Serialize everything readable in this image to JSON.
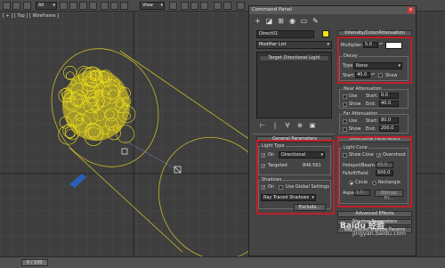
{
  "toolbar": {
    "selection_filter": "All",
    "view_dropdown": "View"
  },
  "viewport": {
    "label": "[ + ] [ Top ] [ Wireframe ]"
  },
  "timeline": {
    "frame_text": "0 / 100"
  },
  "command_panel": {
    "title": "Command Panel",
    "close_glyph": "x",
    "tabs": [
      {
        "icon": "plus-icon",
        "glyph": "+"
      },
      {
        "icon": "modify-icon",
        "glyph": "◪"
      },
      {
        "icon": "hierarchy-icon",
        "glyph": "⊞"
      },
      {
        "icon": "motion-icon",
        "glyph": "◉"
      },
      {
        "icon": "display-icon",
        "glyph": "▭"
      },
      {
        "icon": "utilities-icon",
        "glyph": "✎"
      }
    ],
    "object_name": "Direct01",
    "modifier_list": "Modifier List",
    "stack_item": "Target Directional Light",
    "stack_buttons": [
      "⊢",
      "|",
      "∀",
      "⊕",
      "▣"
    ]
  },
  "general_parameters": {
    "title": "General Parameters",
    "light_type_label": "Light Type",
    "on_label": "On",
    "light_type_value": "Directional",
    "targeted_label": "Targeted",
    "targeted_value": "846.561",
    "shadows_label": "Shadows",
    "shadows_on_label": "On",
    "use_global_label": "Use Global Settings",
    "shadow_type": "Ray Traced Shadows",
    "exclude_button": "Exclude..."
  },
  "intensity": {
    "title": "Intensity/Color/Attenuation",
    "multiplier_label": "Multiplier:",
    "multiplier_value": "5.0",
    "decay_label": "Decay",
    "type_label": "Type:",
    "type_value": "None",
    "start_label": "Start:",
    "start_value": "40.0",
    "show_label": "Show"
  },
  "near_attenuation": {
    "title": "Near Attenuation",
    "use_label": "Use",
    "show_label": "Show",
    "start_label": "Start:",
    "start_value": "0.0",
    "end_label": "End:",
    "end_value": "40.0"
  },
  "far_attenuation": {
    "title": "Far Attenuation",
    "use_label": "Use",
    "show_label": "Show",
    "start_label": "Start:",
    "start_value": "80.0",
    "end_label": "End:",
    "end_value": "200.0"
  },
  "directional_parameters": {
    "title": "Directional Parameters",
    "light_cone_label": "Light Cone",
    "show_cone_label": "Show Cone",
    "overshoot_label": "Overshoot",
    "hotspot_label": "Hotspot/Beam:",
    "hotspot_value": "43.0",
    "falloff_label": "Falloff/Field:",
    "falloff_value": "500.0",
    "circle_label": "Circle",
    "rectangle_label": "Rectangle",
    "aspect_label": "Aspect:",
    "aspect_value": "1.0",
    "bitmap_fit_label": "Bitmap Fit..."
  },
  "collapsed_rollouts": {
    "advanced_effects": "Advanced Effects",
    "shadow_parameters": "Shadow Parameters",
    "ray_traced_params": "Ray Traced Shadow Params"
  },
  "watermark": {
    "logo_text": "Baidu 经验",
    "url_text": "jingyan.baidu.com"
  },
  "colors": {
    "highlight": "#c01f2a",
    "light_object": "#f2e01c",
    "cone_wire": "#c8b82a",
    "blue_object": "#2a5fb8"
  }
}
